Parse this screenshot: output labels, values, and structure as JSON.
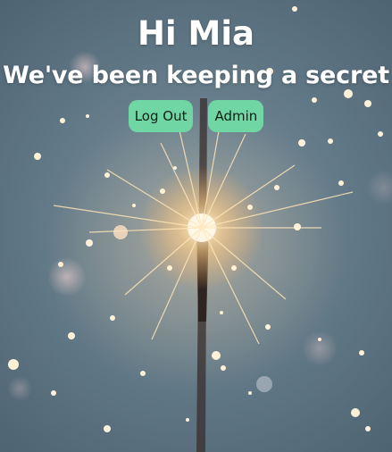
{
  "header": {
    "greeting": "Hi Mia",
    "subtitle": "We've been keeping a secret"
  },
  "actions": {
    "logout_label": "Log Out",
    "admin_label": "Admin",
    "button_color": "#6fd6a4"
  },
  "background": {
    "description_icon": "sparkler-photo",
    "base_color": "#5f7684",
    "spark_color": "#ffe6b8"
  }
}
